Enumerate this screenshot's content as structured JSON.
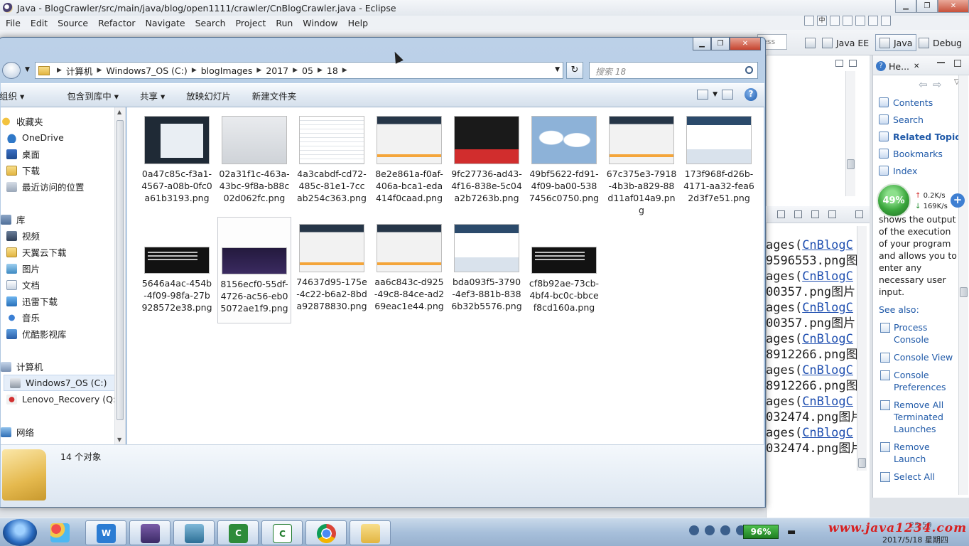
{
  "eclipse": {
    "title": "Java - BlogCrawler/src/main/java/blog/open1111/crawler/CnBlogCrawler.java - Eclipse",
    "menu": [
      "File",
      "Edit",
      "Source",
      "Refactor",
      "Navigate",
      "Search",
      "Project",
      "Run",
      "Window",
      "Help"
    ],
    "quick_access_partial": "ess",
    "perspectives": {
      "javaee": "Java EE",
      "java": "Java",
      "debug": "Debug"
    },
    "console_lines": [
      {
        "prefix": "ages(",
        "link": "CnBlogC"
      },
      {
        "text": "9596553.png图"
      },
      {
        "prefix": "ages(",
        "link": "CnBlogC"
      },
      {
        "text": "00357.png图片"
      },
      {
        "prefix": "ages(",
        "link": "CnBlogC"
      },
      {
        "text": "00357.png图片"
      },
      {
        "prefix": "ages(",
        "link": "CnBlogC"
      },
      {
        "text": "8912266.png图"
      },
      {
        "prefix": "ages(",
        "link": "CnBlogC"
      },
      {
        "text": "8912266.png图"
      },
      {
        "prefix": "ages(",
        "link": "CnBlogC"
      },
      {
        "text": "032474.png图片"
      },
      {
        "prefix": "ages(",
        "link": "CnBlogC"
      },
      {
        "text": "032474.png图片"
      }
    ]
  },
  "help": {
    "tab_title": "He...",
    "links": [
      {
        "label": "Contents",
        "bold": false
      },
      {
        "label": "Search",
        "bold": false
      },
      {
        "label": "Related Topics",
        "bold": true
      },
      {
        "label": "Bookmarks",
        "bold": false
      },
      {
        "label": "Index",
        "bold": false
      }
    ],
    "body": "shows the output of the execution of your program and allows you to enter any necessary user input.",
    "see_also": "See also:",
    "related": [
      "Process Console",
      "Console View",
      "Console Preferences",
      "Remove All Terminated Launches",
      "Remove Launch",
      "Select All"
    ]
  },
  "net_widget": {
    "percent": "49%",
    "up": "0.2K/s",
    "down": "169K/s"
  },
  "explorer": {
    "breadcrumb": [
      "计算机",
      "Windows7_OS (C:)",
      "blogImages",
      "2017",
      "05",
      "18"
    ],
    "search_placeholder": "搜索 18",
    "commands": [
      "组织 ▾",
      "包含到库中 ▾",
      "共享 ▾",
      "放映幻灯片",
      "新建文件夹"
    ],
    "tree": [
      {
        "label": "收藏夹",
        "level": 0,
        "icon": "star-icon"
      },
      {
        "label": "OneDrive",
        "level": 1,
        "icon": "cloud-icon"
      },
      {
        "label": "桌面",
        "level": 1,
        "icon": "desktop-icon"
      },
      {
        "label": "下载",
        "level": 1,
        "icon": "folder-icon"
      },
      {
        "label": "最近访问的位置",
        "level": 1,
        "icon": "recent-icon"
      },
      {
        "label": "库",
        "level": 0,
        "icon": "library-icon",
        "gap": true
      },
      {
        "label": "视频",
        "level": 1,
        "icon": "video-icon"
      },
      {
        "label": "天翼云下载",
        "level": 1,
        "icon": "folder-icon"
      },
      {
        "label": "图片",
        "level": 1,
        "icon": "picture-icon"
      },
      {
        "label": "文档",
        "level": 1,
        "icon": "document-icon"
      },
      {
        "label": "迅雷下载",
        "level": 1,
        "icon": "download-icon"
      },
      {
        "label": "音乐",
        "level": 1,
        "icon": "music-icon"
      },
      {
        "label": "优酷影视库",
        "level": 1,
        "icon": "video-library-icon"
      },
      {
        "label": "计算机",
        "level": 0,
        "icon": "computer-icon",
        "gap": true
      },
      {
        "label": "Windows7_OS (C:)",
        "level": 1,
        "icon": "drive-icon",
        "selected": true
      },
      {
        "label": "Lenovo_Recovery (Q:)",
        "level": 1,
        "icon": "recovery-drive-icon"
      },
      {
        "label": "网络",
        "level": 0,
        "icon": "network-icon",
        "gap": true
      }
    ],
    "files": [
      {
        "name": "0a47c85c-f3a1-4567-a08b-0fc0a61b3193.png",
        "thumb": "dark"
      },
      {
        "name": "02a31f1c-463a-43bc-9f8a-b88c02d062fc.png",
        "thumb": "gray"
      },
      {
        "name": "4a3cabdf-cd72-485c-81e1-7ccab254c363.png",
        "thumb": "doc"
      },
      {
        "name": "8e2e861a-f0af-406a-bca1-eda414f0caad.png",
        "thumb": "web"
      },
      {
        "name": "9fc27736-ad43-4f16-838e-5c04a2b7263b.png",
        "thumb": "blk"
      },
      {
        "name": "49bf5622-fd91-4f09-ba00-5387456c0750.png",
        "thumb": "map"
      },
      {
        "name": "67c375e3-7918-4b3b-a829-88d11af014a9.png",
        "thumb": "web"
      },
      {
        "name": "173f968f-d26b-4171-aa32-fea62d3f7e51.png",
        "thumb": "blue"
      },
      {
        "name": "5646a4ac-454b-4f09-98fa-27b928572e38.png",
        "thumb": "cmd"
      },
      {
        "name": "8156ecf0-55df-4726-ac56-eb05072ae1f9.png",
        "thumb": "purp",
        "selected": true
      },
      {
        "name": "74637d95-175e-4c22-b6a2-8bda92878830.png",
        "thumb": "web"
      },
      {
        "name": "aa6c843c-d925-49c8-84ce-ad269eac1e44.png",
        "thumb": "web"
      },
      {
        "name": "bda093f5-3790-4ef3-881b-8386b32b5576.png",
        "thumb": "blue"
      },
      {
        "name": "cf8b92ae-73cb-4bf4-bc0c-bbcef8cd160a.png",
        "thumb": "cmd"
      }
    ],
    "status_count": "14 个对象"
  },
  "taskbar": {
    "battery": "96%",
    "watermark": "www.java1234.com",
    "date": "2017/5/18 星期四",
    "time_partial": "23:59"
  }
}
